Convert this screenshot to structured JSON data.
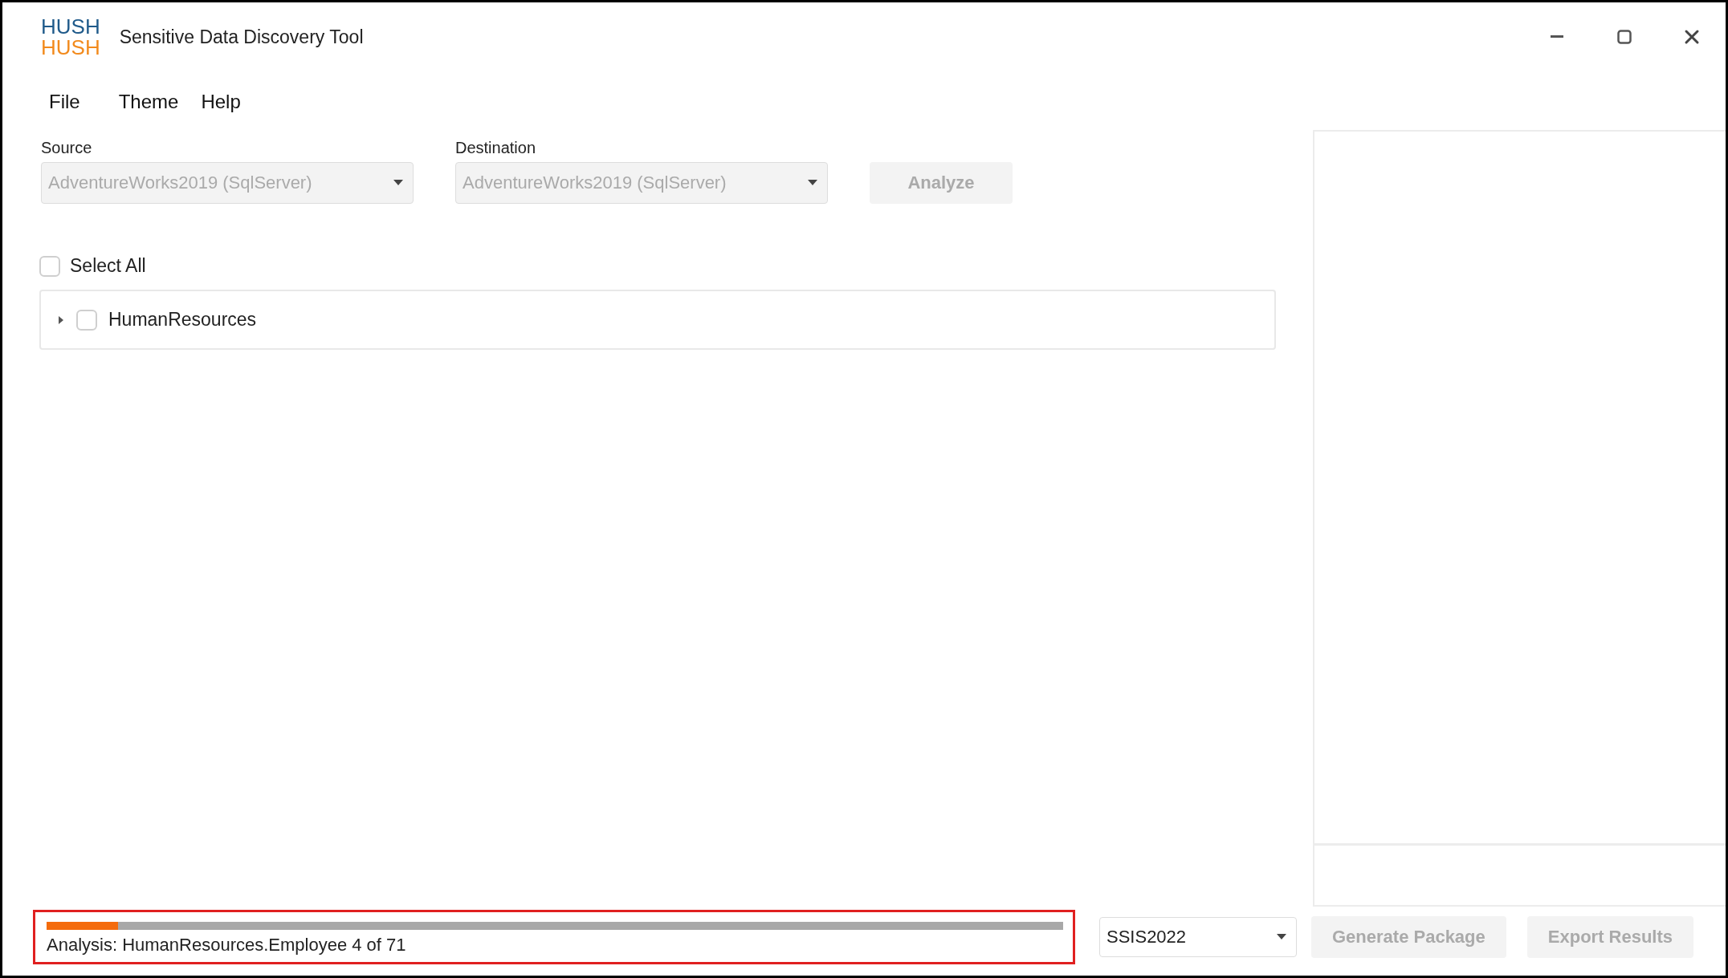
{
  "window": {
    "logo": [
      "HUSH",
      "HUSH"
    ],
    "title": "Sensitive Data Discovery Tool"
  },
  "menu": [
    {
      "label": "File"
    },
    {
      "label": "Theme"
    },
    {
      "label": "Help"
    }
  ],
  "source": {
    "label": "Source",
    "value": "AdventureWorks2019 (SqlServer)",
    "disabled": true
  },
  "destination": {
    "label": "Destination",
    "value": "AdventureWorks2019 (SqlServer)",
    "disabled": true
  },
  "analyze_button": {
    "label": "Analyze",
    "disabled": true
  },
  "select_all": {
    "label": "Select All",
    "checked": false
  },
  "tree": [
    {
      "label": "HumanResources",
      "checked": false,
      "expanded": false
    }
  ],
  "progress": {
    "level": 0.07,
    "status": "Analysis: HumanResources.Employee 4 of 71",
    "highlighted": true
  },
  "package_version": {
    "value": "SSIS2022",
    "disabled": false
  },
  "buttons": [
    {
      "label": "Generate Package",
      "disabled": true
    },
    {
      "label": "Export Results",
      "disabled": true
    }
  ]
}
